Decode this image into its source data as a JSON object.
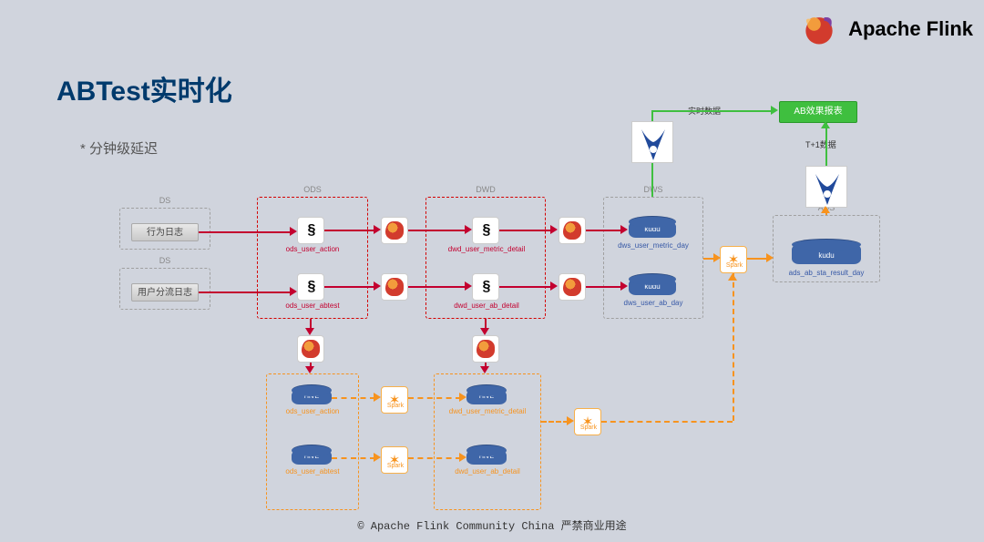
{
  "brand": {
    "name": "Apache Flink"
  },
  "title": "ABTest实时化",
  "bullet": "* 分钟级延迟",
  "footer": "© Apache Flink Community China   严禁商业用途",
  "groups": {
    "ds1": "DS",
    "ds2": "DS",
    "ods": "ODS",
    "dwd": "DWD",
    "dws": "DWS",
    "ads": "ADS"
  },
  "nodes": {
    "behavior_log": "行为日志",
    "user_split_log": "用户分流日志",
    "ods_user_action": "ods_user_action",
    "ods_user_abtest": "ods_user_abtest",
    "dwd_user_metric_detail": "dwd_user_metric_detail",
    "dwd_user_ab_detail": "dwd_user_ab_detail",
    "kudu": "kudu",
    "dws_user_metric_day": "dws_user_metric_day",
    "dws_user_ab_day": "dws_user_ab_day",
    "hive": "HIVE",
    "hive_ods_user_action": "ods_user_action",
    "hive_ods_user_abtest": "ods_user_abtest",
    "hive_dwd_user_metric_detail": "dwd_user_metric_detail",
    "hive_dwd_user_ab_detail": "dwd_user_ab_detail",
    "spark": "Spark",
    "ads_kudu": "kudu",
    "ads_ab_sta_result_day": "ads_ab_sta_result_day",
    "ab_report": "AB效果报表",
    "realtime_data": "实时数据",
    "t1_data": "T+1数据"
  },
  "icons": {
    "flink_logo": "flink-squirrel",
    "kafka": "kafka-icon",
    "flink_mini": "flink-mini-icon",
    "spark": "spark-icon",
    "impala": "impala-icon"
  }
}
